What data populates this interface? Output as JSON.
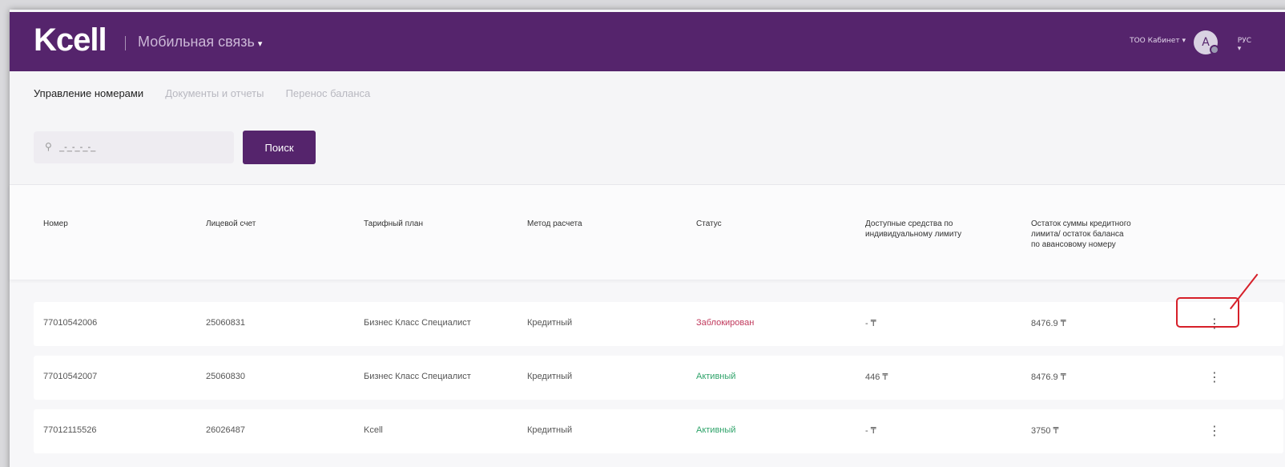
{
  "header": {
    "brand": "Kcell",
    "service": "Мобильная связь",
    "company": "ТОО Кабинет",
    "avatar_letter": "A",
    "lang": "РУС"
  },
  "tabs": [
    {
      "label": "Управление номерами",
      "active": true
    },
    {
      "label": "Документы и отчеты",
      "active": false
    },
    {
      "label": "Перенос баланса",
      "active": false
    }
  ],
  "search": {
    "placeholder": "_-_-_-_-_",
    "button_label": "Поиск"
  },
  "table": {
    "columns": [
      "Номер",
      "Лицевой счет",
      "Тарифный план",
      "Метод расчета",
      "Статус",
      "Доступные средства по индивидуальному лимиту",
      "Остаток суммы кредитного лимита/ остаток баланса по авансовому номеру"
    ],
    "rows": [
      {
        "number": "77010542006",
        "account": "25060831",
        "plan": "Бизнес Класс Специалист",
        "method": "Кредитный",
        "status": "Заблокирован",
        "status_type": "blocked",
        "available": "- ₸",
        "balance": "8476.9 ₸"
      },
      {
        "number": "77010542007",
        "account": "25060830",
        "plan": "Бизнес Класс Специалист",
        "method": "Кредитный",
        "status": "Активный",
        "status_type": "active",
        "available": "446 ₸",
        "balance": "8476.9 ₸"
      },
      {
        "number": "77012115526",
        "account": "26026487",
        "plan": "Kcell",
        "method": "Кредитный",
        "status": "Активный",
        "status_type": "active",
        "available": "- ₸",
        "balance": "3750 ₸"
      }
    ]
  },
  "colors": {
    "brand_purple": "#55246c",
    "status_blocked": "#c0395c",
    "status_active": "#2fa36a",
    "annotation_red": "#d6202a"
  }
}
